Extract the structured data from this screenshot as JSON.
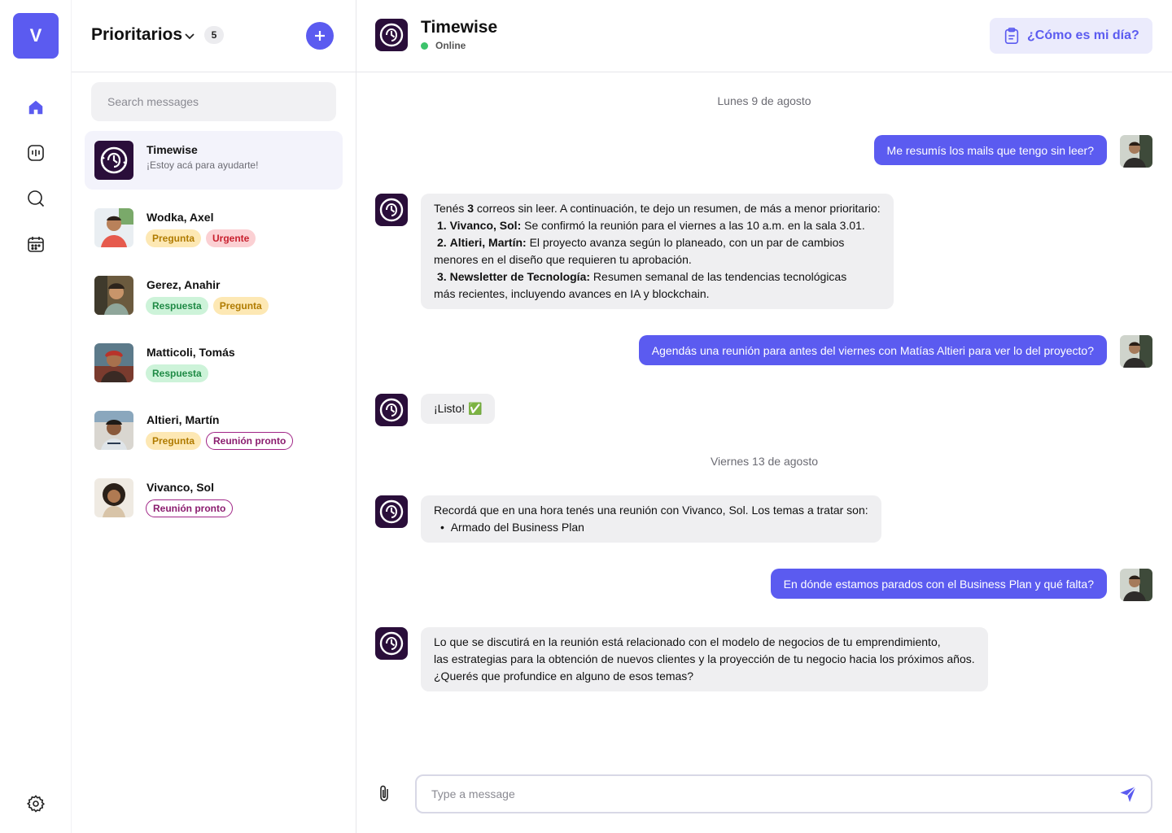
{
  "colors": {
    "accent": "#5b5bf0",
    "bot_bg": "#2a0e3a",
    "online": "#3cc36b"
  },
  "rail": {
    "logo_letter": "V",
    "icons": [
      "home-icon",
      "dashboard-icon",
      "search-icon",
      "calendar-icon",
      "settings-icon"
    ]
  },
  "list": {
    "title": "Prioritarios",
    "count": "5",
    "search_placeholder": "Search messages",
    "conversations": [
      {
        "name": "Timewise",
        "subtitle": "¡Estoy acá para ayudarte!",
        "active": true,
        "tags": []
      },
      {
        "name": "Wodka, Axel",
        "tags": [
          "Pregunta",
          "Urgente"
        ]
      },
      {
        "name": "Gerez, Anahir",
        "tags": [
          "Respuesta",
          "Pregunta"
        ]
      },
      {
        "name": "Matticoli, Tomás",
        "tags": [
          "Respuesta"
        ]
      },
      {
        "name": "Altieri, Martín",
        "tags": [
          "Pregunta",
          "Reunión pronto"
        ]
      },
      {
        "name": "Vivanco, Sol",
        "tags": [
          "Reunión pronto"
        ]
      }
    ]
  },
  "chat": {
    "title": "Timewise",
    "status": "Online",
    "day_button": "¿Cómo es mi día?",
    "dates": [
      "Lunes 9 de agosto",
      "Viernes 13 de agosto"
    ],
    "messages": [
      {
        "from": "user",
        "text": "Me resumís los mails que tengo sin leer?"
      },
      {
        "from": "bot",
        "lines": [
          {
            "parts": [
              "Tenés ",
              "3",
              " correos sin leer. A continuación, te dejo un resumen, de más a menor prioritario:"
            ]
          },
          {
            "num": "1.",
            "bold": "Vivanco, Sol:",
            "text": " Se confirmó la reunión para el viernes a las 10 a.m. en la sala 3.01."
          },
          {
            "num": "2.",
            "bold": "Altieri, Martín:",
            "text": " El proyecto avanza según lo planeado, con un par de cambios"
          },
          {
            "text": "menores en el diseño que requieren tu aprobación."
          },
          {
            "num": "3.",
            "bold": "Newsletter de Tecnología:",
            "text": " Resumen semanal de las tendencias tecnológicas"
          },
          {
            "text": "más recientes, incluyendo avances en IA y blockchain."
          }
        ]
      },
      {
        "from": "user",
        "text": "Agendás una reunión para antes del viernes con Matías Altieri para ver lo del proyecto?"
      },
      {
        "from": "bot",
        "text": "¡Listo!",
        "emoji": "✅"
      },
      {
        "from": "bot",
        "lines": [
          {
            "text": "Recordá que en una hora tenés una reunión con Vivanco, Sol. Los temas a tratar son:"
          },
          {
            "bullet": "•",
            "text": "Armado del Business Plan"
          }
        ]
      },
      {
        "from": "user",
        "text": "En dónde estamos parados con el Business Plan y qué falta?"
      },
      {
        "from": "bot",
        "lines": [
          {
            "text": "Lo que se discutirá en la reunión está relacionado con el modelo de negocios de tu emprendimiento,"
          },
          {
            "text": "las estrategias para la obtención de nuevos clientes y la proyección de tu negocio hacia los próximos años."
          },
          {
            "text": "¿Querés que profundice en alguno de esos temas?"
          }
        ]
      }
    ],
    "composer_placeholder": "Type a message"
  }
}
